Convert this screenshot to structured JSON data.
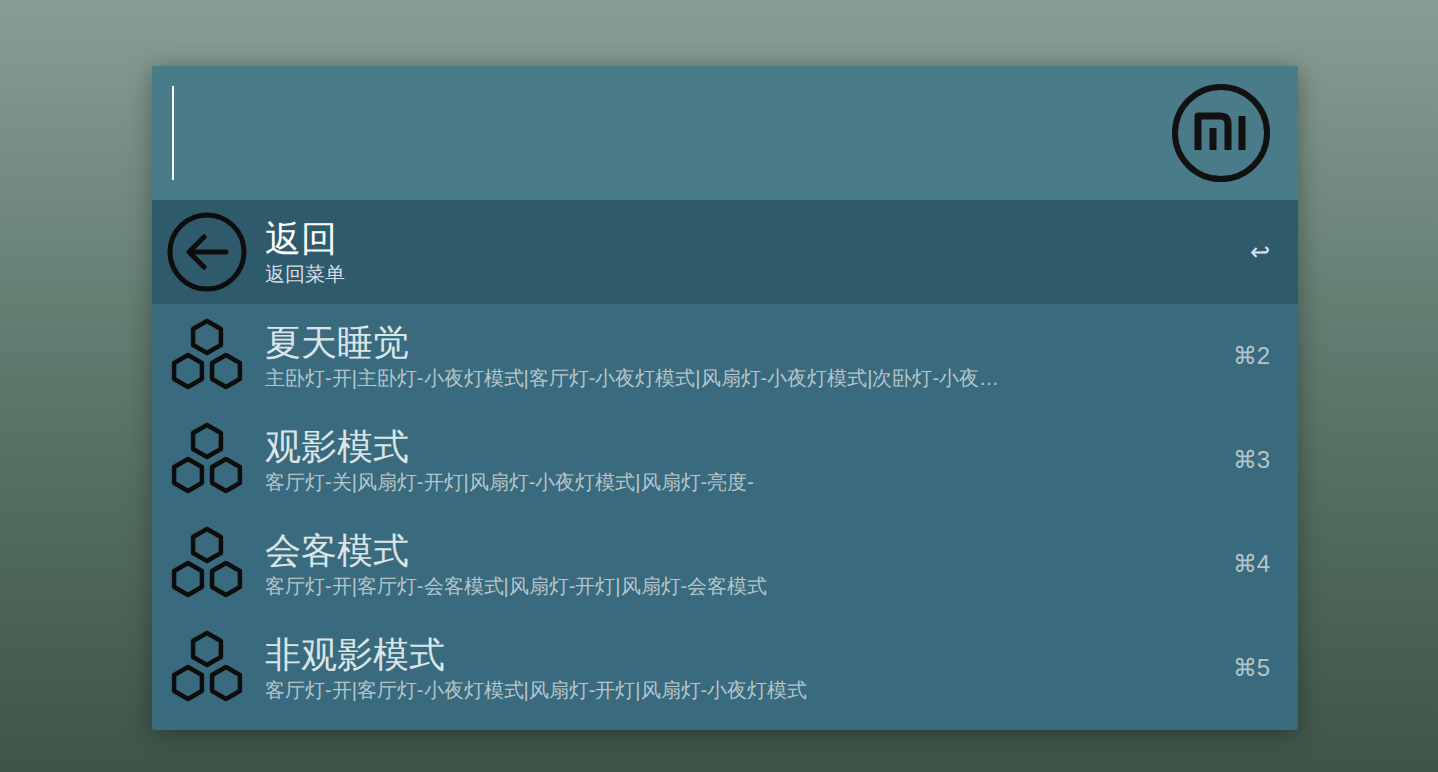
{
  "search": {
    "value": ""
  },
  "results": [
    {
      "title": "返回",
      "subtitle": "返回菜单",
      "shortcut": "↩",
      "selected": true,
      "kind": "back"
    },
    {
      "title": "夏天睡觉",
      "subtitle": "主卧灯-开|主卧灯-小夜灯模式|客厅灯-小夜灯模式|风扇灯-小夜灯模式|次卧灯-小夜…",
      "shortcut": "⌘2",
      "selected": false,
      "kind": "scene"
    },
    {
      "title": "观影模式",
      "subtitle": "客厅灯-关|风扇灯-开灯|风扇灯-小夜灯模式|风扇灯-亮度-",
      "shortcut": "⌘3",
      "selected": false,
      "kind": "scene"
    },
    {
      "title": "会客模式",
      "subtitle": "客厅灯-开|客厅灯-会客模式|风扇灯-开灯|风扇灯-会客模式",
      "shortcut": "⌘4",
      "selected": false,
      "kind": "scene"
    },
    {
      "title": "非观影模式",
      "subtitle": "客厅灯-开|客厅灯-小夜灯模式|风扇灯-开灯|风扇灯-小夜灯模式",
      "shortcut": "⌘5",
      "selected": false,
      "kind": "scene"
    }
  ]
}
